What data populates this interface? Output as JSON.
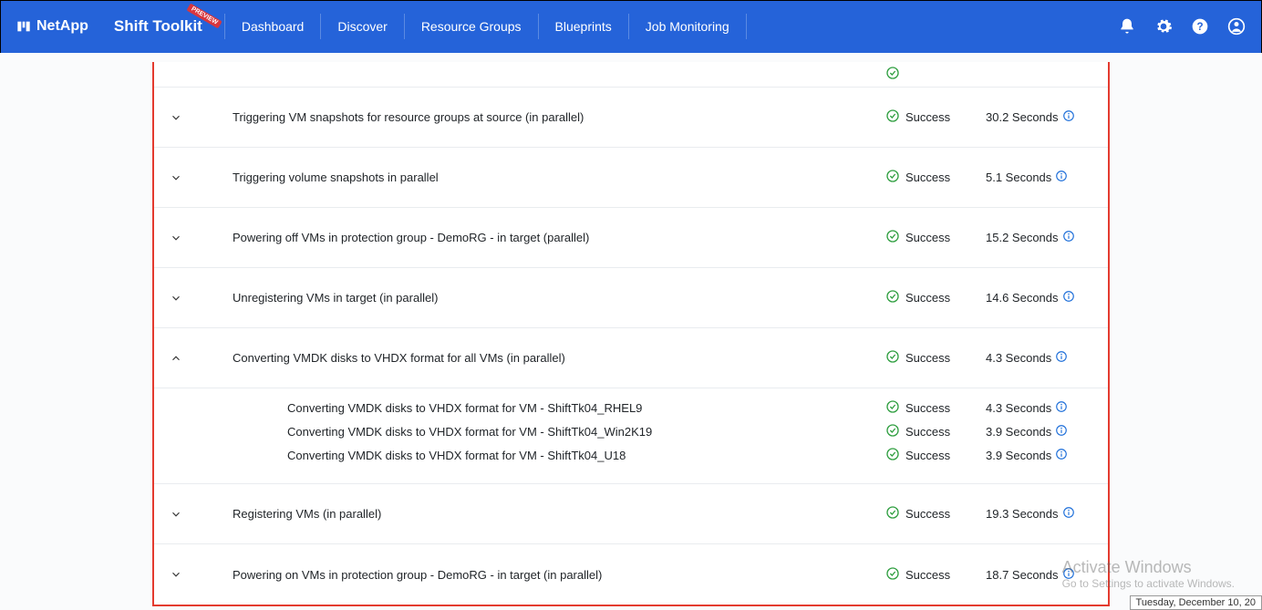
{
  "header": {
    "brand": "NetApp",
    "app_title": "Shift Toolkit",
    "preview_badge": "PREVIEW",
    "nav": [
      "Dashboard",
      "Discover",
      "Resource Groups",
      "Blueprints",
      "Job Monitoring"
    ]
  },
  "steps": [
    {
      "desc": "Triggering VM snapshots for resource groups at source (in parallel)",
      "status": "Success",
      "duration": "30.2 Seconds",
      "expanded": false
    },
    {
      "desc": "Triggering volume snapshots in parallel",
      "status": "Success",
      "duration": "5.1 Seconds",
      "expanded": false
    },
    {
      "desc": "Powering off VMs in protection group - DemoRG - in target (parallel)",
      "status": "Success",
      "duration": "15.2 Seconds",
      "expanded": false
    },
    {
      "desc": "Unregistering VMs in target (in parallel)",
      "status": "Success",
      "duration": "14.6 Seconds",
      "expanded": false
    },
    {
      "desc": "Converting VMDK disks to VHDX format for all VMs (in parallel)",
      "status": "Success",
      "duration": "4.3 Seconds",
      "expanded": true,
      "sub": [
        {
          "desc": "Converting VMDK disks to VHDX format for VM - ShiftTk04_RHEL9",
          "status": "Success",
          "duration": "4.3 Seconds"
        },
        {
          "desc": "Converting VMDK disks to VHDX format for VM - ShiftTk04_Win2K19",
          "status": "Success",
          "duration": "3.9 Seconds"
        },
        {
          "desc": "Converting VMDK disks to VHDX format for VM - ShiftTk04_U18",
          "status": "Success",
          "duration": "3.9 Seconds"
        }
      ]
    },
    {
      "desc": "Registering VMs (in parallel)",
      "status": "Success",
      "duration": "19.3 Seconds",
      "expanded": false
    },
    {
      "desc": "Powering on VMs in protection group - DemoRG - in target (in parallel)",
      "status": "Success",
      "duration": "18.7 Seconds",
      "expanded": false
    }
  ],
  "watermark": {
    "title": "Activate Windows",
    "sub": "Go to Settings to activate Windows."
  },
  "tray_date": "Tuesday, December 10, 20"
}
